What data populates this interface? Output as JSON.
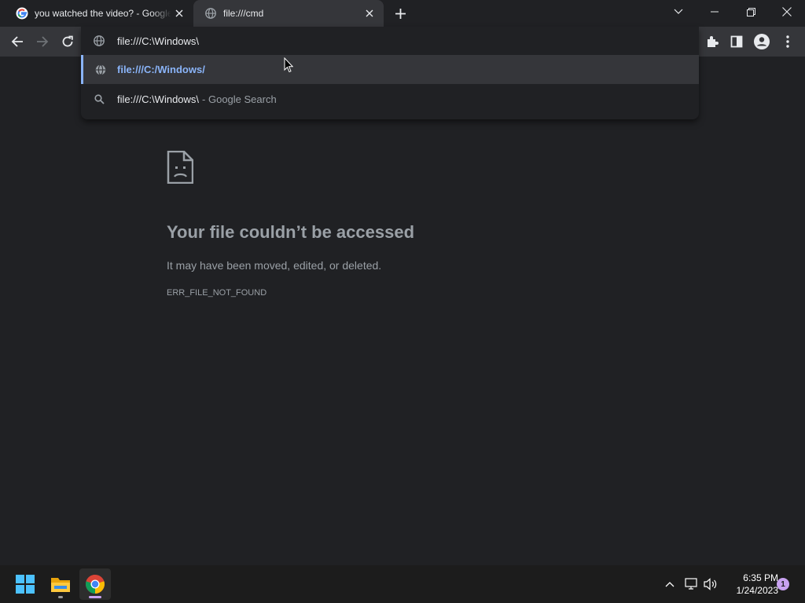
{
  "tabs": [
    {
      "title": "you watched the video? - Google Search",
      "favicon": "google-icon"
    },
    {
      "title": "file:///cmd",
      "favicon": "globe-icon"
    }
  ],
  "omnibox": {
    "value": "file:///C:\\Windows\\",
    "suggestions": [
      {
        "text": "file:///C:/Windows/",
        "suffix": "",
        "icon": "globe-icon"
      },
      {
        "text": "file:///C:\\Windows\\",
        "suffix": "- Google Search",
        "icon": "search-icon"
      }
    ]
  },
  "error_page": {
    "icon": "sad-file-icon",
    "title": "Your file couldn’t be accessed",
    "description": "It may have been moved, edited, or deleted.",
    "code": "ERR_FILE_NOT_FOUND"
  },
  "taskbar": {
    "time": "6:35 PM",
    "date": "1/24/2023",
    "notification_count": "1"
  },
  "colors": {
    "accent": "#8ab4f8",
    "background": "#202124",
    "toolbar": "#35363a",
    "muted_text": "#9aa0a6"
  }
}
